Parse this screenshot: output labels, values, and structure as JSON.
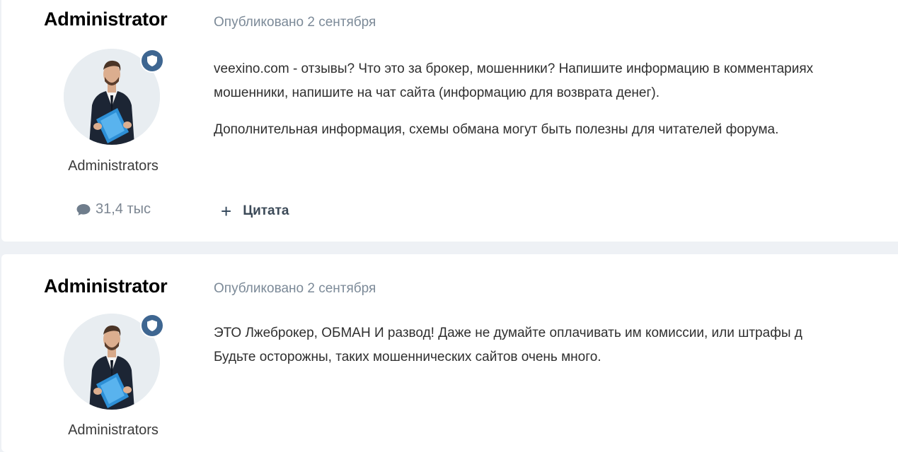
{
  "posts": [
    {
      "author": "Administrator",
      "group": "Administrators",
      "post_count": "31,4 тыс",
      "published": "Опубликовано 2 сентября",
      "paragraphs": [
        "veexino.com - отзывы? Что это за брокер, мошенники? Напишите информацию в комментариях",
        "мошенники, напишите на чат сайта (информацию для возврата денег).",
        "Дополнительная информация, схемы обмана могут быть полезны для читателей форума."
      ],
      "quote_label": "Цитата"
    },
    {
      "author": "Administrator",
      "group": "Administrators",
      "published": "Опубликовано 2 сентября",
      "paragraphs": [
        "ЭТО Лжеброкер, ОБМАН И развод! Даже не думайте оплачивать им комиссии, или штрафы д",
        "Будьте осторожны, таких мошеннических сайтов очень много."
      ]
    }
  ],
  "icons": {
    "badge": "shield-icon",
    "stats": "comment-icon",
    "quote": "plus-icon"
  },
  "colors": {
    "page_bg": "#eef1f5",
    "card_bg": "#ffffff",
    "badge": "#3e6691",
    "meta": "#7c8a98"
  }
}
